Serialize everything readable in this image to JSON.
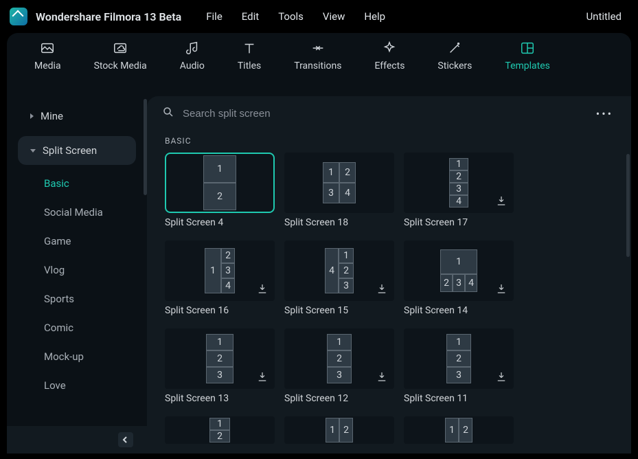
{
  "titlebar": {
    "app_name": "Wondershare Filmora 13 Beta",
    "menus": [
      "File",
      "Edit",
      "Tools",
      "View",
      "Help"
    ],
    "project_name": "Untitled"
  },
  "top_tabs": [
    {
      "id": "media",
      "label": "Media"
    },
    {
      "id": "stock-media",
      "label": "Stock Media"
    },
    {
      "id": "audio",
      "label": "Audio"
    },
    {
      "id": "titles",
      "label": "Titles"
    },
    {
      "id": "transitions",
      "label": "Transitions"
    },
    {
      "id": "effects",
      "label": "Effects"
    },
    {
      "id": "stickers",
      "label": "Stickers"
    },
    {
      "id": "templates",
      "label": "Templates"
    }
  ],
  "active_top_tab": "templates",
  "sidebar": {
    "sections": [
      {
        "id": "mine",
        "label": "Mine",
        "expanded": false
      },
      {
        "id": "split-screen",
        "label": "Split Screen",
        "expanded": true
      }
    ],
    "split_screen_items": [
      {
        "id": "basic",
        "label": "Basic",
        "active": true
      },
      {
        "id": "social-media",
        "label": "Social Media",
        "active": false
      },
      {
        "id": "game",
        "label": "Game",
        "active": false
      },
      {
        "id": "vlog",
        "label": "Vlog",
        "active": false
      },
      {
        "id": "sports",
        "label": "Sports",
        "active": false
      },
      {
        "id": "comic",
        "label": "Comic",
        "active": false
      },
      {
        "id": "mock-up",
        "label": "Mock-up",
        "active": false
      },
      {
        "id": "love",
        "label": "Love",
        "active": false
      }
    ]
  },
  "search": {
    "placeholder": "Search split screen"
  },
  "section_header": "BASIC",
  "templates": [
    {
      "id": "ss4",
      "label": "Split Screen 4",
      "selected": true,
      "download": false
    },
    {
      "id": "ss18",
      "label": "Split Screen 18",
      "selected": false,
      "download": false
    },
    {
      "id": "ss17",
      "label": "Split Screen 17",
      "selected": false,
      "download": true
    },
    {
      "id": "ss16",
      "label": "Split Screen 16",
      "selected": false,
      "download": true
    },
    {
      "id": "ss15",
      "label": "Split Screen 15",
      "selected": false,
      "download": true
    },
    {
      "id": "ss14",
      "label": "Split Screen 14",
      "selected": false,
      "download": true
    },
    {
      "id": "ss13",
      "label": "Split Screen 13",
      "selected": false,
      "download": true
    },
    {
      "id": "ss12",
      "label": "Split Screen 12",
      "selected": false,
      "download": true
    },
    {
      "id": "ss11",
      "label": "Split Screen 11",
      "selected": false,
      "download": true
    }
  ]
}
